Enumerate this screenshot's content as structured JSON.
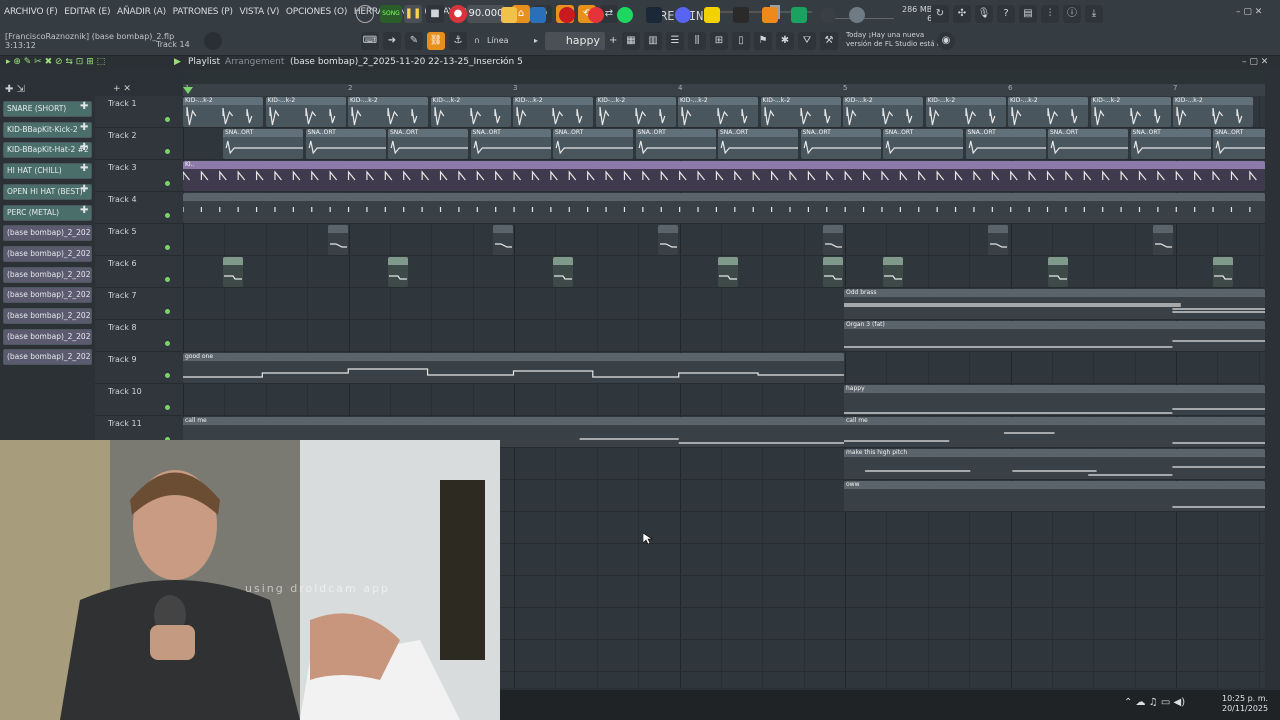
{
  "menu": [
    "ARCHIVO (F)",
    "EDITAR (E)",
    "AÑADIR (A)",
    "PATRONES (P)",
    "VISTA (V)",
    "OPCIONES (O)",
    "HERRAMIENTAS (T)",
    "AYUDA"
  ],
  "transport": {
    "tempo": "90.000",
    "rec_in": "REC IN 2",
    "memory_top": "286 MB",
    "memory_bottom": "6"
  },
  "project": {
    "path": "[FranciscoRaznoznik] (base bombap)_2.flp",
    "time": "3:13:12",
    "focused_track": "Track 14"
  },
  "toolbar": {
    "snap": "Línea",
    "pattern": "happy"
  },
  "news": {
    "line1": "Today  ¡Hay una nueva",
    "line2": "versión de FL Studio está d..."
  },
  "playlist": {
    "title": "Playlist",
    "separator": "›",
    "mode": "Arrangement",
    "file": "(base bombap)_2_2025-11-20 22-13-25_Inserción 5",
    "chevron": "›"
  },
  "ruler": [
    "1",
    "2",
    "3",
    "4",
    "5",
    "6",
    "7"
  ],
  "browser": {
    "items": [
      {
        "label": "SNARE (SHORT)",
        "kind": "g"
      },
      {
        "label": "KID-BBapKit-Kick-2",
        "kind": "g"
      },
      {
        "label": "KID-BBapKit-Hat-2 #2",
        "kind": "g"
      },
      {
        "label": "HI HAT (CHILL)",
        "kind": "g"
      },
      {
        "label": "OPEN HI HAT (BEST)",
        "kind": "g"
      },
      {
        "label": "PERC (METAL)",
        "kind": "g"
      },
      {
        "label": "(base bombap)_2_2025-...",
        "kind": "p"
      },
      {
        "label": "(base bombap)_2_2025-...",
        "kind": "p"
      },
      {
        "label": "(base bombap)_2_2025-...",
        "kind": "p"
      },
      {
        "label": "(base bombap)_2_2025-...",
        "kind": "p"
      },
      {
        "label": "(base bombap)_2_2025-...",
        "kind": "p"
      },
      {
        "label": "(base bombap)_2_2025-...",
        "kind": "p"
      },
      {
        "label": "(base bombap)_2_2025-...",
        "kind": "p"
      }
    ]
  },
  "tracks": [
    "Track 1",
    "Track 2",
    "Track 3",
    "Track 4",
    "Track 5",
    "Track 6",
    "Track 7",
    "Track 8",
    "Track 9",
    "Track 10",
    "Track 11"
  ],
  "clips": {
    "kick": "KID-...k-2",
    "snare": "SNA..ORT",
    "hat": "KI..",
    "odd_brass": "Odd brass",
    "organ": "Organ 3 (fat)",
    "good_one": "good one",
    "happy": "happy",
    "call_me_a": "call me",
    "call_me_b": "call me",
    "high_pitch": "make this high pitch",
    "oww": "oww"
  },
  "webcam": {
    "watermark": "using droidcam app"
  },
  "clock": {
    "time": "10:25 p. m.",
    "date": "20/11/2025"
  },
  "colors": {
    "accent_orange": "#e8901e",
    "record_red": "#d8343a",
    "active_dot": "#7dd36b",
    "clip_purple": "#8e7aa8",
    "pick_green": "#4a6e6a"
  }
}
